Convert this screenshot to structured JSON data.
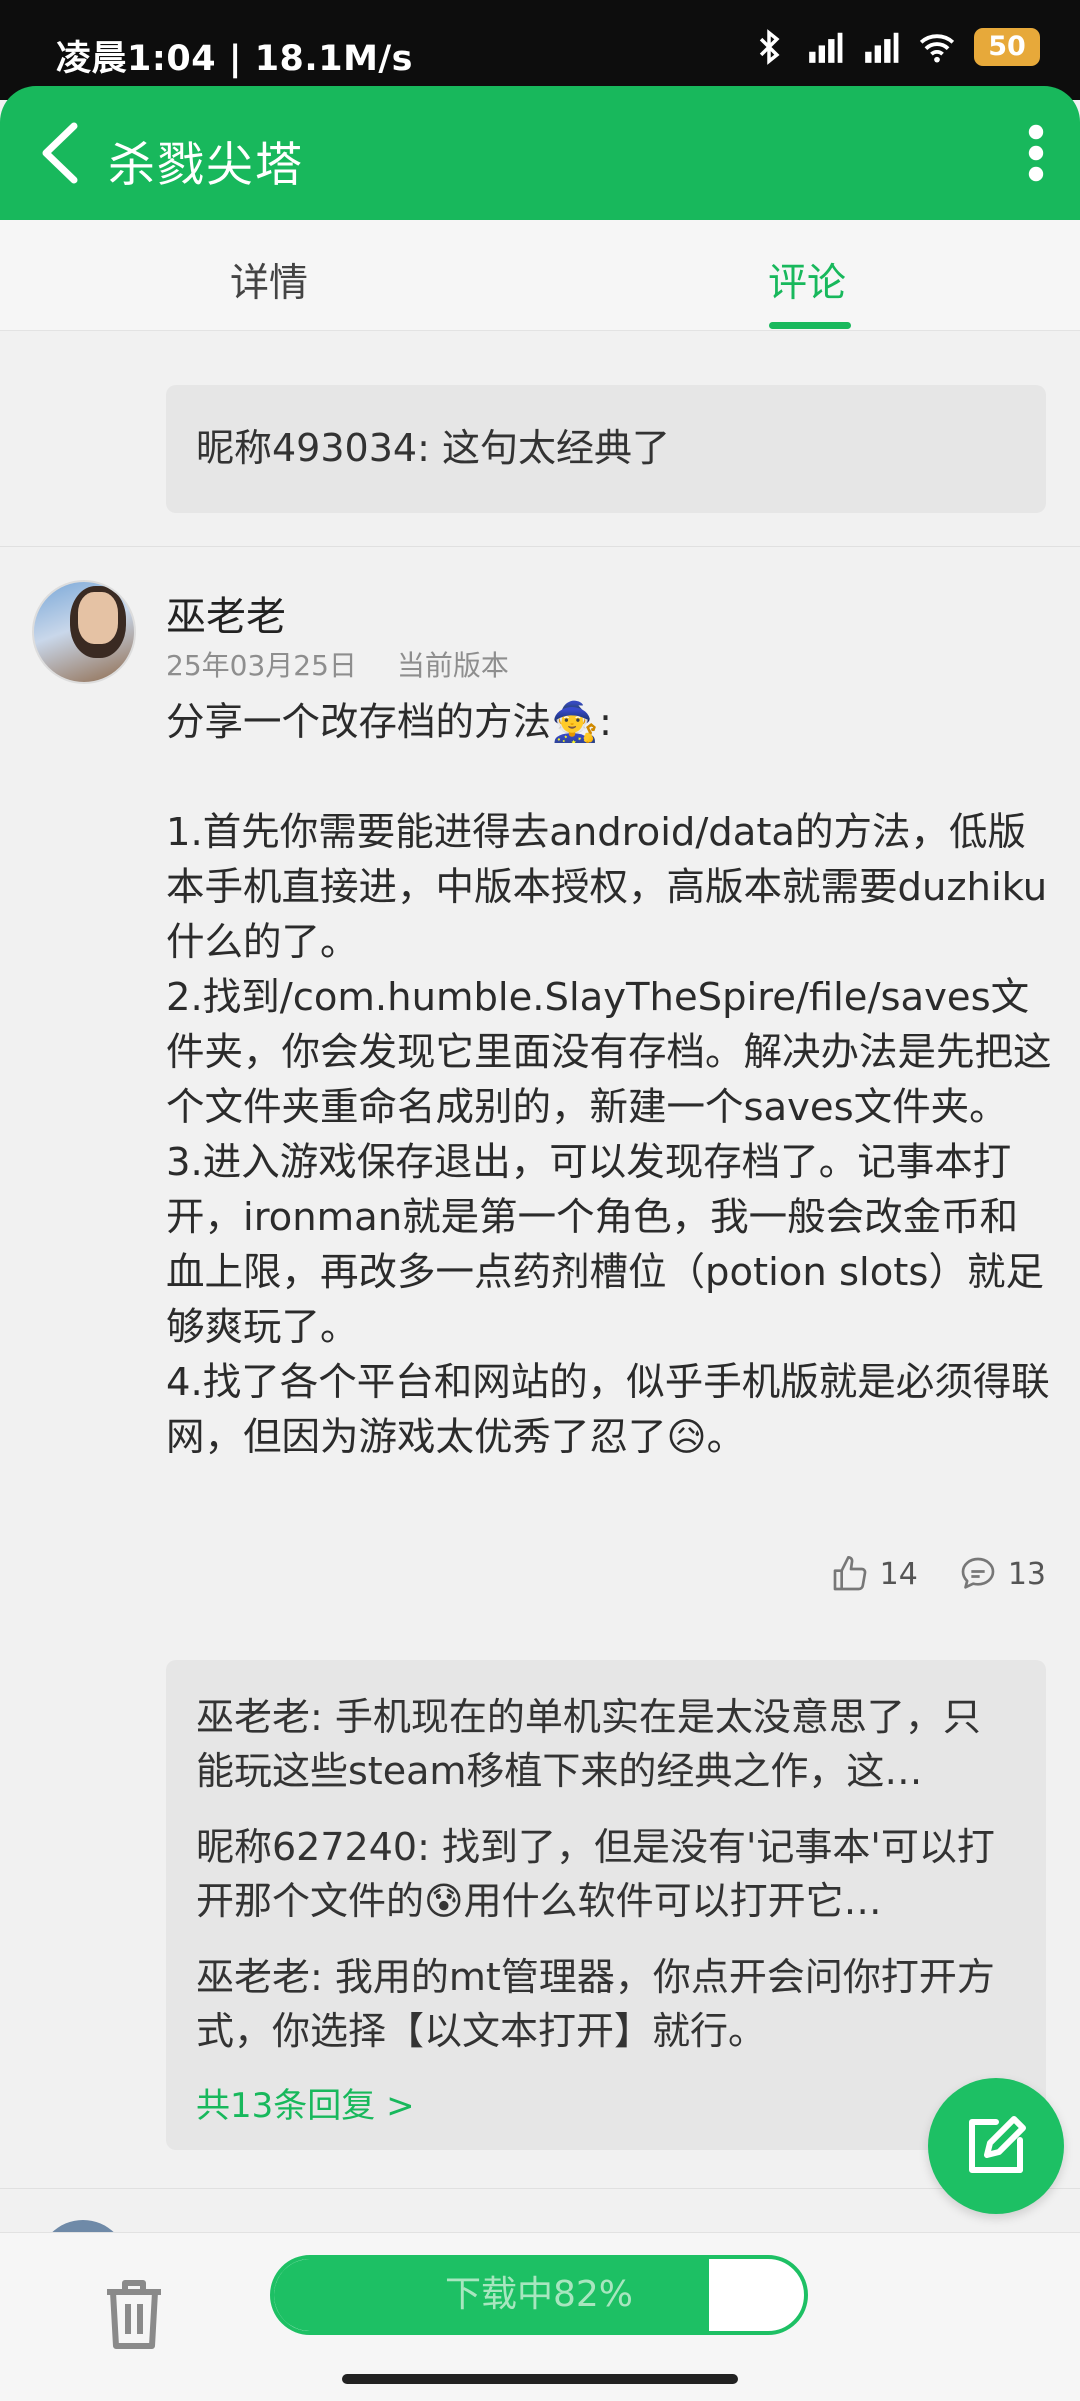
{
  "status_bar": {
    "time_speed": "凌晨1:04 | 18.1M/s",
    "battery": "50",
    "icons": [
      "mute-icon",
      "alarm-icon",
      "app-icon",
      "bluetooth-icon",
      "signal-icon",
      "signal-icon",
      "wifi-icon"
    ]
  },
  "app_bar": {
    "title": "杀戮尖塔",
    "back_icon": "back-arrow-icon",
    "menu_icon": "more-vert-icon"
  },
  "tabs": [
    {
      "label": "详情"
    },
    {
      "label": "评论",
      "active": true
    }
  ],
  "top_reply": {
    "name": "昵称493034",
    "text": ": 这句太经典了"
  },
  "comment": {
    "user": "巫老老",
    "date": "25年03月25日",
    "version": "当前版本",
    "text": "分享一个改存档的方法🧙:\n\n1.首先你需要能进得去android/data的方法，低版本手机直接进，中版本授权，高版本就需要duzhiku什么的了。\n2.找到/com.humble.SlayTheSpire/file/saves文件夹，你会发现它里面没有存档。解决办法是先把这个文件夹重命名成别的，新建一个saves文件夹。\n3.进入游戏保存退出，可以发现存档了。记事本打开，ironman就是第一个角色，我一般会改金币和血上限，再改多一点药剂槽位（potion slots）就足够爽玩了。\n4.找了各个平台和网站的，似乎手机版就是必须得联网，但因为游戏太优秀了忍了😥。",
    "likes": "14",
    "replies_count": "13",
    "replies": [
      {
        "name": "巫老老",
        "text": ": 手机现在的单机实在是太没意思了，只能玩这些steam移植下来的经典之作，这…"
      },
      {
        "name": "昵称627240",
        "text": ": 找到了，但是没有'记事本'可以打开那个文件的😰用什么软件可以打开它…"
      },
      {
        "name": "巫老老",
        "text": ": 我用的mt管理器，你点开会问你打开方式，你选择【以文本打开】就行。"
      }
    ],
    "more_replies": "共13条回复 >"
  },
  "bottom_bar": {
    "download_label": "下载中82%",
    "download_progress": 0.82
  },
  "colors": {
    "accent": "#18b85c",
    "battery": "#e7a93a"
  }
}
